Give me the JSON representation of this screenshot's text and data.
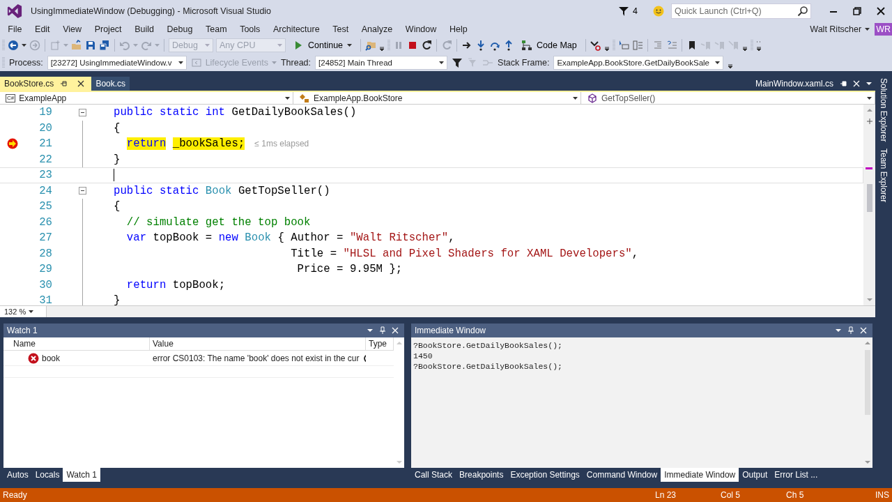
{
  "window": {
    "title": "UsingImmediateWindow (Debugging) - Microsoft Visual Studio",
    "notification_count": "4",
    "quick_launch": {
      "placeholder": "Quick Launch (Ctrl+Q)"
    }
  },
  "menu": [
    "File",
    "Edit",
    "View",
    "Project",
    "Build",
    "Debug",
    "Team",
    "Tools",
    "Architecture",
    "Test",
    "Analyze",
    "Window",
    "Help"
  ],
  "user": {
    "name": "Walt Ritscher",
    "initials": "WR"
  },
  "toolbar": {
    "configuration": {
      "value": "Debug",
      "disabled": true
    },
    "platform": {
      "value": "Any CPU",
      "disabled": true
    },
    "continue_label": "Continue",
    "code_map_label": "Code Map"
  },
  "debug_location": {
    "process_label": "Process:",
    "process": "[23272] UsingImmediateWindow.v",
    "lifecycle": {
      "label": "Lifecycle Events",
      "disabled": true
    },
    "thread_label": "Thread:",
    "thread": "[24852] Main Thread",
    "stack_frame_label": "Stack Frame:",
    "stack_frame": "ExampleApp.BookStore.GetDailyBookSale"
  },
  "document_tabs": [
    {
      "label": "BookStore.cs",
      "selected": true
    },
    {
      "label": "Book.cs",
      "selected": false
    }
  ],
  "overflow_tab": "MainWindow.xaml.cs",
  "navigation": {
    "project_badge": "C#",
    "project": "ExampleApp",
    "type": "ExampleApp.BookStore",
    "member": "GetTopSeller()"
  },
  "editor": {
    "zoom": "132 %",
    "lines": [
      {
        "number": "19",
        "kind": "plain",
        "collapsible": true,
        "tokens": [
          {
            "text": "public static int",
            "kind": "keyword"
          },
          {
            "text": " GetDailyBookSales()",
            "kind": "plain"
          }
        ]
      },
      {
        "number": "20",
        "kind": "plain",
        "collapsible": false,
        "tokens": [
          {
            "text": "{",
            "kind": "plain"
          }
        ]
      },
      {
        "number": "21",
        "kind": "breakpoint",
        "collapsible": false,
        "hint": "≤ 1ms elapsed",
        "tokens": [
          {
            "text": "  return",
            "kind": "keyword"
          },
          {
            "text": " _bookSales;",
            "kind": "plain"
          }
        ]
      },
      {
        "number": "22",
        "kind": "plain",
        "collapsible": false,
        "tokens": [
          {
            "text": "}",
            "kind": "plain"
          }
        ]
      },
      {
        "number": "23",
        "kind": "caret",
        "collapsible": false
      },
      {
        "number": "24",
        "kind": "plain",
        "collapsible": true,
        "tokens": [
          {
            "text": "public static",
            "kind": "keyword"
          },
          {
            "text": " Book",
            "kind": "type"
          },
          {
            "text": " GetTopSeller()",
            "kind": "plain"
          }
        ]
      },
      {
        "number": "25",
        "kind": "plain",
        "collapsible": false,
        "tokens": [
          {
            "text": "{",
            "kind": "plain"
          }
        ]
      },
      {
        "number": "26",
        "kind": "plain",
        "collapsible": false,
        "tokens": [
          {
            "text": "  // simulate get the top book",
            "kind": "comment"
          }
        ]
      },
      {
        "number": "27",
        "kind": "plain",
        "collapsible": false,
        "tokens": [
          {
            "text": "  var",
            "kind": "keyword"
          },
          {
            "text": " topBook = ",
            "kind": "plain"
          },
          {
            "text": "new",
            "kind": "keyword"
          },
          {
            "text": " Book",
            "kind": "type"
          },
          {
            "text": " { Author = ",
            "kind": "plain"
          },
          {
            "text": "\"Walt Ritscher\"",
            "kind": "string"
          },
          {
            "text": ",",
            "kind": "plain"
          }
        ]
      },
      {
        "number": "28",
        "kind": "plain",
        "collapsible": false,
        "tokens": [
          {
            "text": "                           Title = ",
            "kind": "plain"
          },
          {
            "text": "\"HLSL and Pixel Shaders for XAML Developers\"",
            "kind": "string"
          },
          {
            "text": ",",
            "kind": "plain"
          }
        ]
      },
      {
        "number": "29",
        "kind": "plain",
        "collapsible": false,
        "tokens": [
          {
            "text": "                            Price = 9.95M };",
            "kind": "plain"
          }
        ]
      },
      {
        "number": "30",
        "kind": "plain",
        "collapsible": false,
        "tokens": [
          {
            "text": "  return",
            "kind": "keyword"
          },
          {
            "text": " topBook;",
            "kind": "plain"
          }
        ]
      },
      {
        "number": "31",
        "kind": "plain",
        "collapsible": false,
        "tokens": [
          {
            "text": "}",
            "kind": "plain"
          }
        ]
      }
    ]
  },
  "side_tabs": [
    "Solution Explorer",
    "Team Explorer"
  ],
  "watch": {
    "title": "Watch 1",
    "columns": [
      "Name",
      "Value",
      "Type"
    ],
    "rows": [
      {
        "name": "book",
        "value": "error CS0103: The name 'book' does not exist in the cur",
        "error": true
      }
    ],
    "tabs": [
      {
        "label": "Autos",
        "selected": false
      },
      {
        "label": "Locals",
        "selected": false
      },
      {
        "label": "Watch 1",
        "selected": true
      }
    ]
  },
  "immediate": {
    "title": "Immediate Window",
    "lines": [
      "?BookStore.GetDailyBookSales();",
      "1450",
      "?BookStore.GetDailyBookSales();"
    ],
    "tabs": [
      {
        "label": "Call Stack",
        "selected": false
      },
      {
        "label": "Breakpoints",
        "selected": false
      },
      {
        "label": "Exception Settings",
        "selected": false
      },
      {
        "label": "Command Window",
        "selected": false
      },
      {
        "label": "Immediate Window",
        "selected": true
      },
      {
        "label": "Output",
        "selected": false
      },
      {
        "label": "Error List ...",
        "selected": false
      }
    ]
  },
  "status_bar": {
    "message": "Ready",
    "line": "Ln 23",
    "column": "Col 5",
    "char": "Ch 5",
    "mode": "INS"
  }
}
